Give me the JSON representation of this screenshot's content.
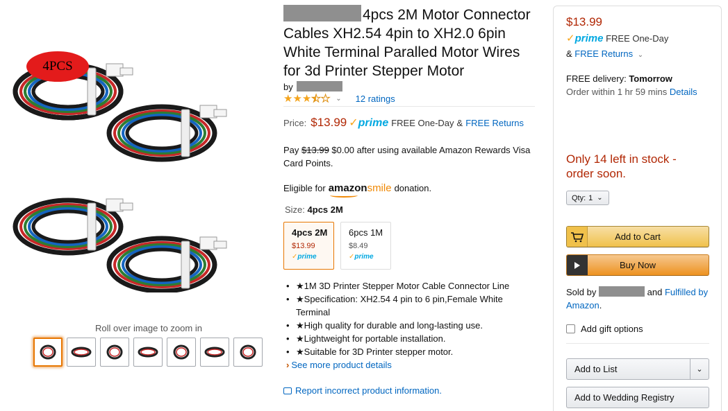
{
  "images": {
    "badge_text": "4PCS",
    "zoom_hint": "Roll over image to zoom in",
    "thumb_count": 7
  },
  "product": {
    "title": "4pcs 2M Motor Connector Cables XH2.54 4pin to XH2.0 6pin White Terminal Paralled Motor Wires for 3d Printer Stepper Motor",
    "by_label": "by",
    "rating_stars": 3.5,
    "ratings_link": "12 ratings",
    "price_label": "Price:",
    "price": "$13.99",
    "prime_label": "prime",
    "one_day": "FREE One-Day",
    "and": "&",
    "free_returns": "FREE Returns",
    "pay_prefix": "Pay",
    "pay_strike": "$13.99",
    "pay_suffix": "$0.00 after using available Amazon Rewards Visa Card Points.",
    "smile_prefix": "Eligible for",
    "smile_logo_a": "amazon",
    "smile_logo_b": "smile",
    "smile_suffix": "donation.",
    "size_label": "Size:",
    "size_value": "4pcs 2M",
    "variants": [
      {
        "name": "4pcs 2M",
        "price": "$13.99",
        "prime": "prime"
      },
      {
        "name": "6pcs 1M",
        "price": "$8.49",
        "prime": "prime"
      }
    ],
    "bullets": [
      "★1M 3D Printer Stepper Motor Cable Connector Line",
      "★Specification: XH2.54 4 pin to 6 pin,Female White Terminal",
      "★High quality for durable and long-lasting use.",
      "★Lightweight for portable installation.",
      "★Suitable for 3D Printer stepper motor."
    ],
    "see_more": "See more product details",
    "report": "Report incorrect product information."
  },
  "buybox": {
    "price": "$13.99",
    "prime_label": "prime",
    "one_day": "FREE One-Day",
    "returns_prefix": "&",
    "returns": "FREE Returns",
    "delivery_label": "FREE delivery:",
    "delivery_day": "Tomorrow",
    "order_within": "Order within 1 hr 59 mins",
    "details": "Details",
    "stock": "Only 14 left in stock - order soon.",
    "qty_label": "Qty:",
    "qty_value": "1",
    "add_to_cart": "Add to Cart",
    "buy_now": "Buy Now",
    "sold_by": "Sold by",
    "and": "and",
    "fulfilled_by": "Fulfilled by Amazon",
    "period": ".",
    "gift": "Add gift options",
    "add_to_list": "Add to List",
    "wedding": "Add to Wedding Registry"
  },
  "colors": {
    "price_red": "#b12704",
    "link_blue": "#0066c0",
    "prime_blue": "#00a8e1",
    "selection_orange": "#e77600",
    "star_gold": "#f4a41d"
  }
}
